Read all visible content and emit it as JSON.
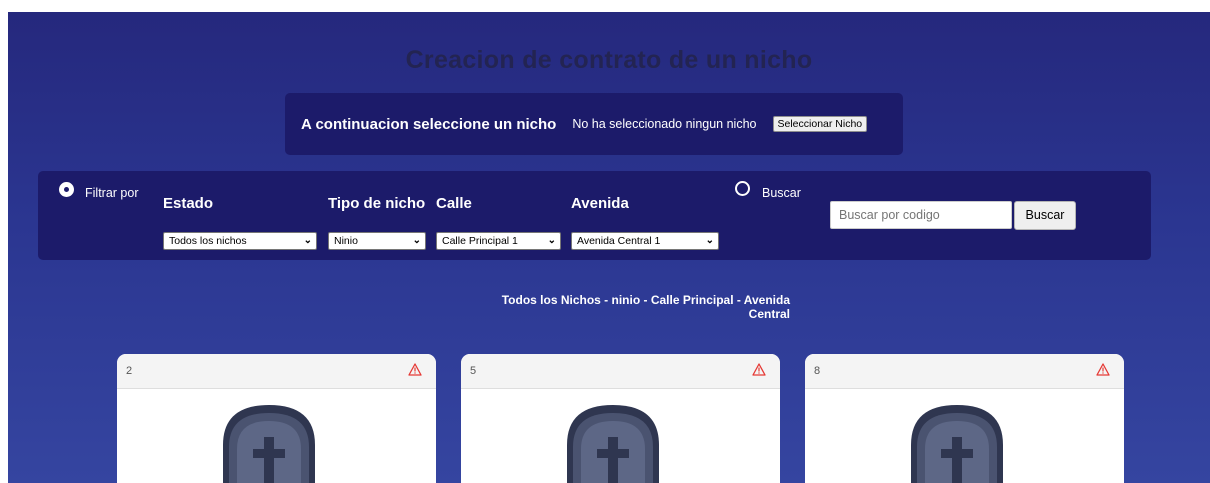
{
  "page": {
    "title": "Creacion de contrato de un nicho"
  },
  "selection": {
    "heading": "A continuacion seleccione un nicho",
    "status": "No ha seleccionado ningun nicho",
    "button_label": "Seleccionar Nicho"
  },
  "filters": {
    "filter_radio_label": "Filtrar por",
    "search_radio_label": "Buscar",
    "estado": {
      "label": "Estado",
      "selected": "Todos los nichos"
    },
    "tipo": {
      "label": "Tipo de nicho",
      "selected": "Ninio"
    },
    "calle": {
      "label": "Calle",
      "selected": "Calle Principal 1"
    },
    "avenida": {
      "label": "Avenida",
      "selected": "Avenida Central 1"
    },
    "search": {
      "placeholder": "Buscar por codigo",
      "button_label": "Buscar"
    }
  },
  "results": {
    "caption_line1": "Todos los Nichos - ninio - Calle Principal - Avenida",
    "caption_line2": "Central",
    "cards": [
      {
        "id": "2",
        "icon": "warning-icon"
      },
      {
        "id": "5",
        "icon": "warning-icon"
      },
      {
        "id": "8",
        "icon": "warning-icon"
      }
    ]
  },
  "colors": {
    "panel": "#1c1b6a",
    "background_top": "#25287d",
    "background_bottom": "#3545a0",
    "warning": "#e53935",
    "tomb": "#4a5370"
  }
}
